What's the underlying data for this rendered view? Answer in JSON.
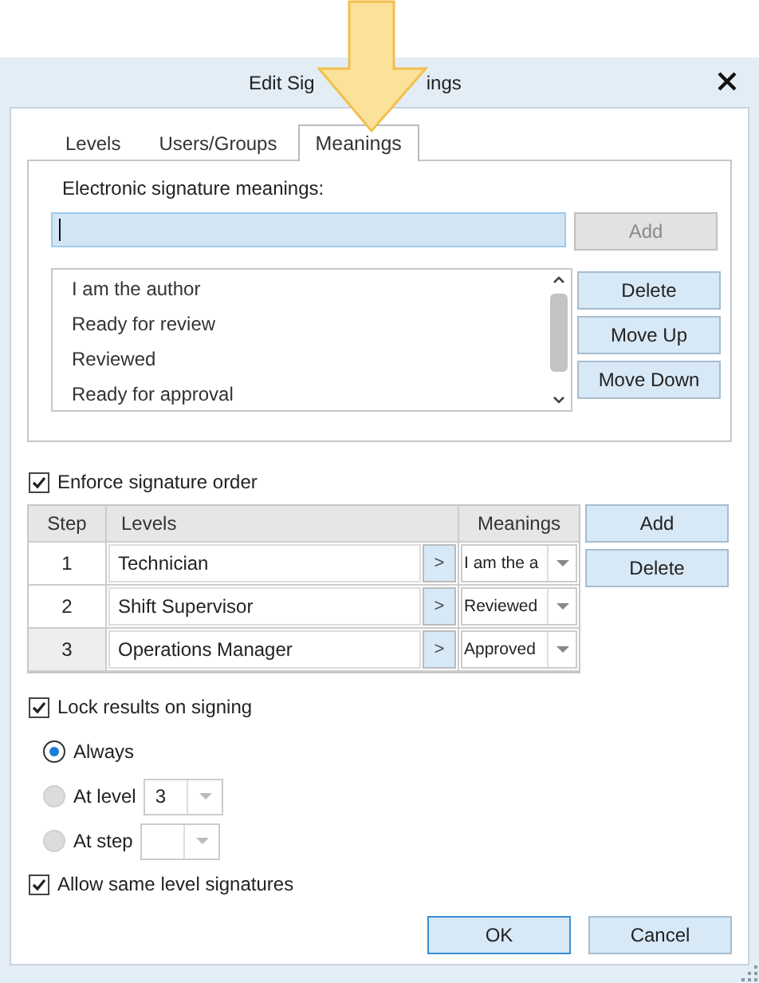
{
  "window": {
    "title_parts": [
      "Edit Sig",
      "ings"
    ]
  },
  "tabs": [
    {
      "label": "Levels",
      "selected": false
    },
    {
      "label": "Users/Groups",
      "selected": false
    },
    {
      "label": "Meanings",
      "selected": true
    }
  ],
  "meanings": {
    "label": "Electronic signature meanings:",
    "input": {
      "focused": true
    },
    "add_button": {
      "label": "Add",
      "disabled": true
    },
    "list": [
      "I am the author",
      "Ready for review",
      "Reviewed",
      "Ready for approval"
    ],
    "buttons": [
      {
        "label": "Delete"
      },
      {
        "label": "Move Up"
      },
      {
        "label": "Move Down"
      }
    ]
  },
  "signature_order": {
    "label": "Enforce signature order",
    "checked": true,
    "table": {
      "columns": [
        "Step",
        "Levels",
        "Meanings"
      ],
      "rows": [
        {
          "step": "1",
          "level": "Technician",
          "expand": ">",
          "meaning": "I am the a",
          "selected": false
        },
        {
          "step": "2",
          "level": "Shift Supervisor",
          "expand": ">",
          "meaning": "Reviewed",
          "selected": false
        },
        {
          "step": "3",
          "level": "Operations Manager",
          "expand": ">",
          "meaning": "Approved",
          "selected": true
        }
      ]
    },
    "buttons": [
      {
        "label": "Add"
      },
      {
        "label": "Delete"
      }
    ]
  },
  "lock": {
    "label": "Lock results on signing",
    "checked": true,
    "options": [
      {
        "label": "Always",
        "selected": true,
        "disabled": false,
        "kind": "plain"
      },
      {
        "label": "At level",
        "selected": false,
        "disabled": true,
        "kind": "combo",
        "value": "3"
      },
      {
        "label": "At step",
        "selected": false,
        "disabled": true,
        "kind": "combo"
      }
    ]
  },
  "allow_same": {
    "label": "Allow same level signatures",
    "checked": true
  },
  "footer": [
    {
      "label": "OK",
      "default": true
    },
    {
      "label": "Cancel",
      "default": false
    }
  ]
}
